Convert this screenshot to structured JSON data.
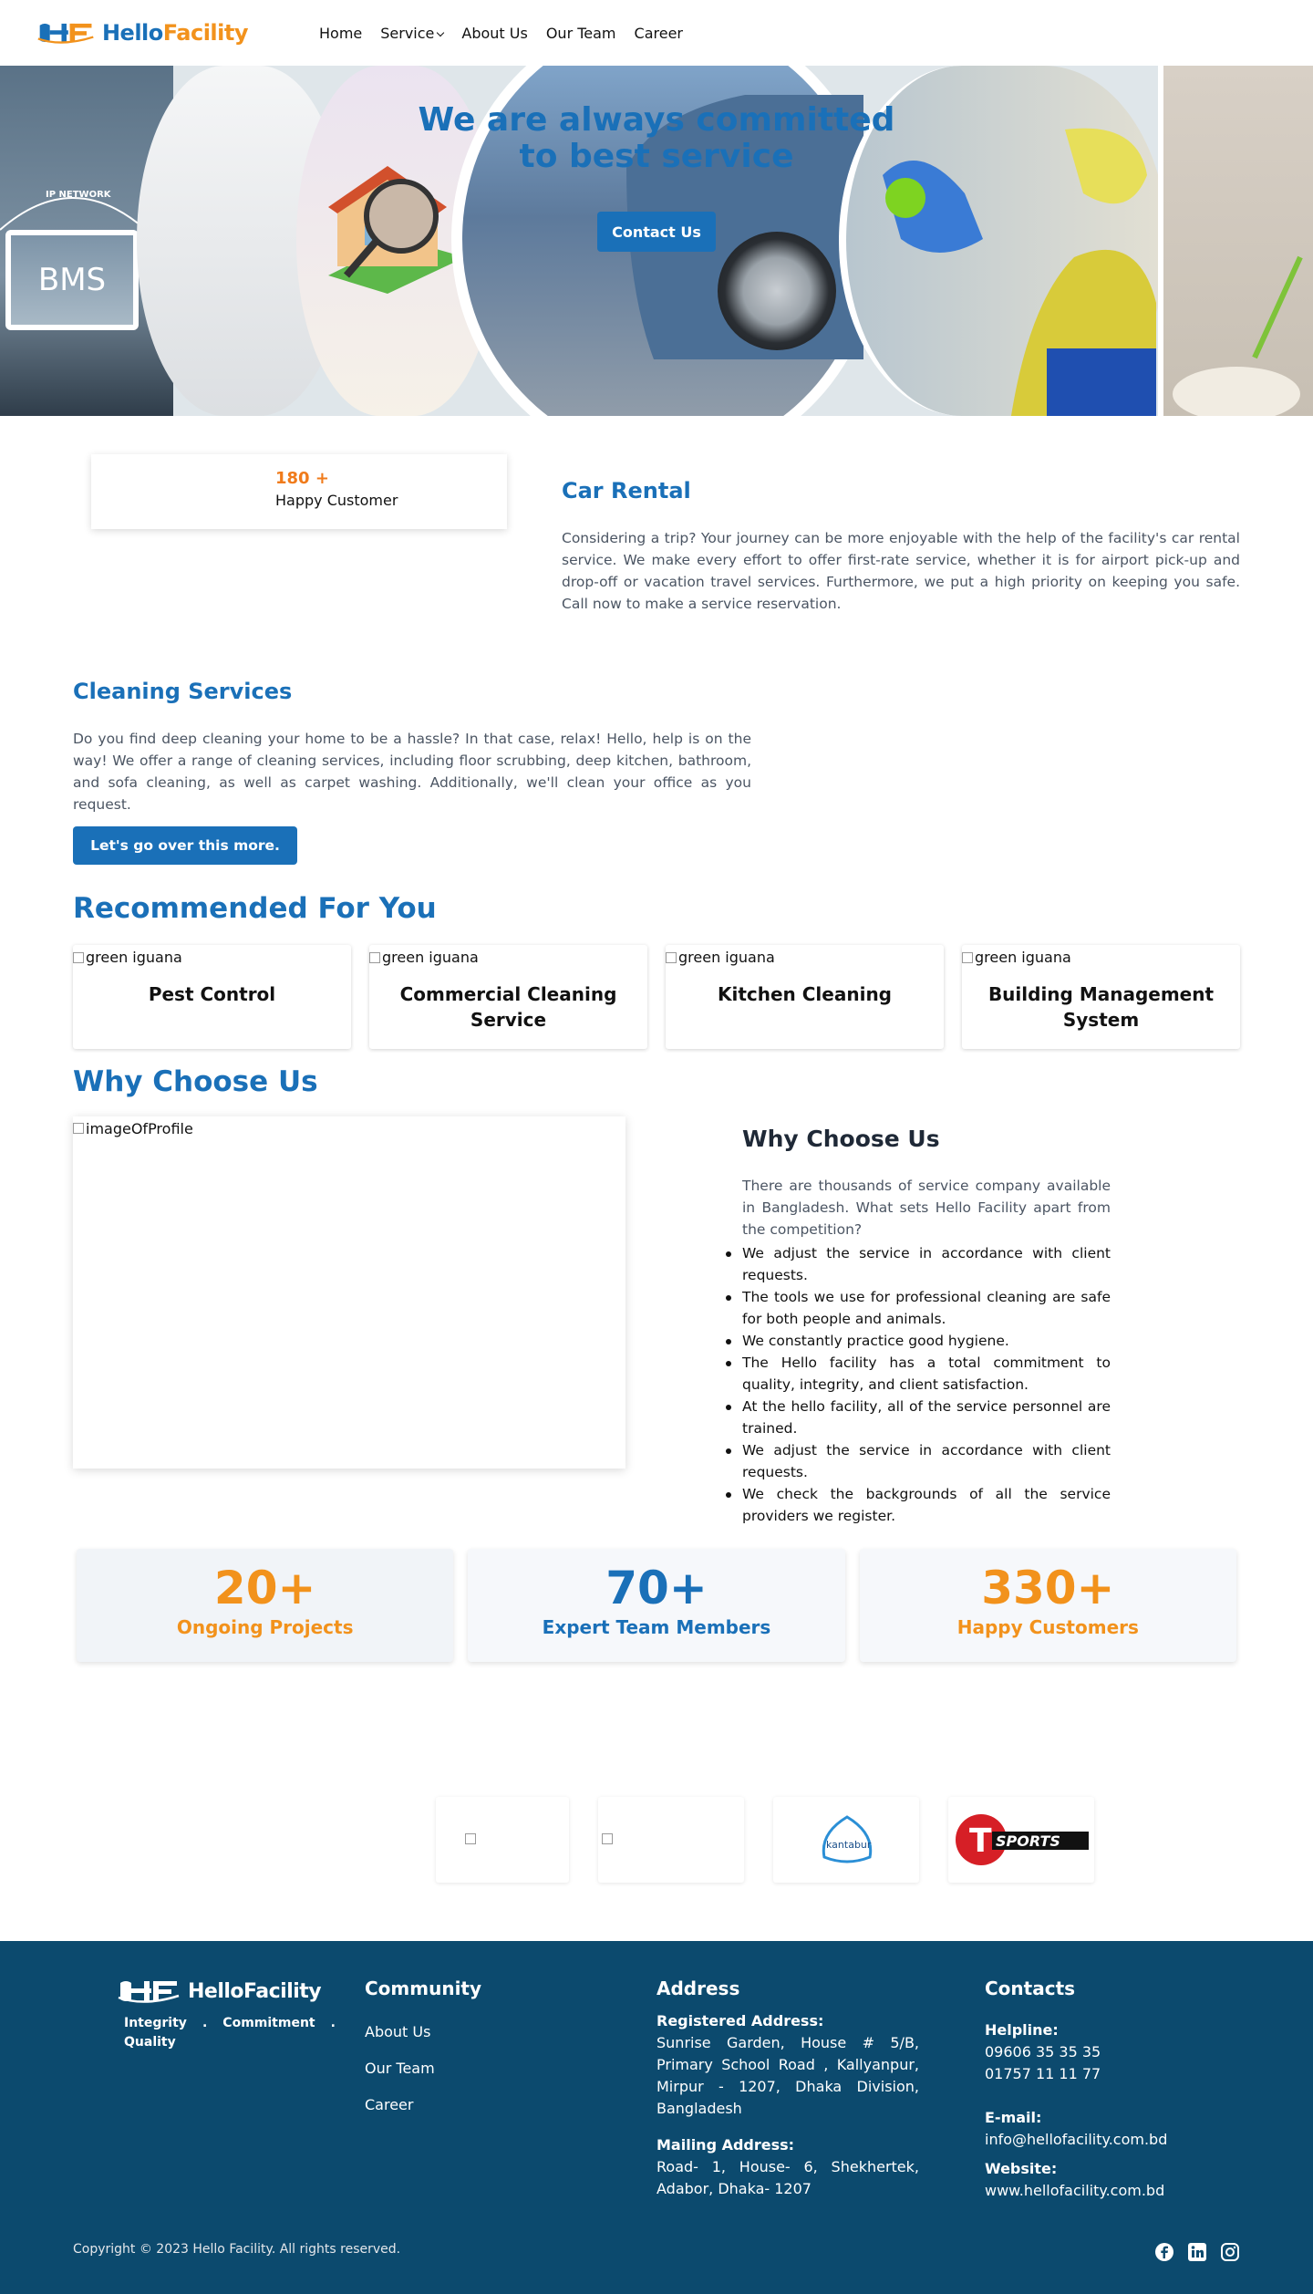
{
  "brand": {
    "name_part1": "Hello",
    "name_part2": "Facility",
    "color_blue": "#1a70b8",
    "color_orange": "#f2921c"
  },
  "nav": {
    "items": [
      "Home",
      "Service",
      "About Us",
      "Our Team",
      "Career"
    ]
  },
  "hero": {
    "title_line1": "We are always committed",
    "title_line2": "to best service",
    "button": "Contact Us",
    "panel_text": "BMS",
    "panel_caption": "IP NETWORK"
  },
  "counter": {
    "value": "180 +",
    "label": "Happy Customer"
  },
  "car_rental": {
    "title": "Car Rental",
    "text": "Considering a trip? Your journey can be more enjoyable with the help of the facility's car rental service. We make every effort to offer first-rate service, whether it is for airport pick-up and drop-off or vacation travel services. Furthermore, we put a high priority on keeping you safe. Call now to make a service reservation."
  },
  "cleaning": {
    "title": "Cleaning Services",
    "text": "Do you find deep cleaning your home to be a hassle? In that case, relax! Hello, help is on the way! We offer a range of cleaning services, including floor scrubbing, deep kitchen, bathroom, and sofa cleaning, as well as carpet washing. Additionally, we'll clean your office as you request.",
    "button": "Let's go over this more."
  },
  "recommended": {
    "title": "Recommended For You",
    "image_alt": "green iguana",
    "cards": [
      "Pest Control",
      "Commercial Cleaning Service",
      "Kitchen Cleaning",
      "Building Management System"
    ]
  },
  "why": {
    "title": "Why Choose Us",
    "image_alt": "imageOfProfile",
    "subtitle": "Why Choose Us",
    "intro": "There are thousands of service company available in Bangladesh. What sets Hello Facility apart from the competition?",
    "points": [
      "We adjust the service in accordance with client requests.",
      "The tools we use for professional cleaning are safe for both people and animals.",
      "We constantly practice good hygiene.",
      "The Hello facility has a total commitment to quality, integrity, and client satisfaction.",
      "At the hello facility, all of the service personnel are trained.",
      "We adjust the service in accordance with client requests.",
      "We check the backgrounds of all the service providers we register."
    ]
  },
  "stats": [
    {
      "value": "20+",
      "label": "Ongoing Projects"
    },
    {
      "value": "70+",
      "label": "Expert Team Members"
    },
    {
      "value": "330+",
      "label": "Happy Customers"
    }
  ],
  "clients": {
    "logo3_text": "kantabur",
    "logo4_text": "SPORTS",
    "logo4_letter": "T"
  },
  "footer": {
    "logo_text": "HelloFacility",
    "tagline": [
      "Integrity",
      ".",
      "Commitment",
      ".",
      "Quality"
    ],
    "community_title": "Community",
    "community_links": [
      "About Us",
      "Our Team",
      "Career"
    ],
    "address_title": "Address",
    "registered_label": "Registered Address:",
    "registered_text": "Sunrise Garden, House # 5/B, Primary School Road , Kallyanpur, Mirpur - 1207, Dhaka Division, Bangladesh",
    "mailing_label": "Mailing Address:",
    "mailing_text": "Road- 1, House- 6, Shekhertek, Adabor, Dhaka- 1207",
    "contacts_title": "Contacts",
    "helpline_label": "Helpline:",
    "helpline_1": "09606 35 35 35",
    "helpline_2": "01757 11 11 77",
    "email_label": "E-mail:",
    "email": "info@hellofacility.com.bd",
    "website_label": "Website:",
    "website": "www.hellofacility.com.bd",
    "copyright": "Copyright © 2023 Hello Facility. All rights reserved.",
    "social_icons": [
      "facebook-icon",
      "linkedin-icon",
      "instagram-icon"
    ]
  }
}
